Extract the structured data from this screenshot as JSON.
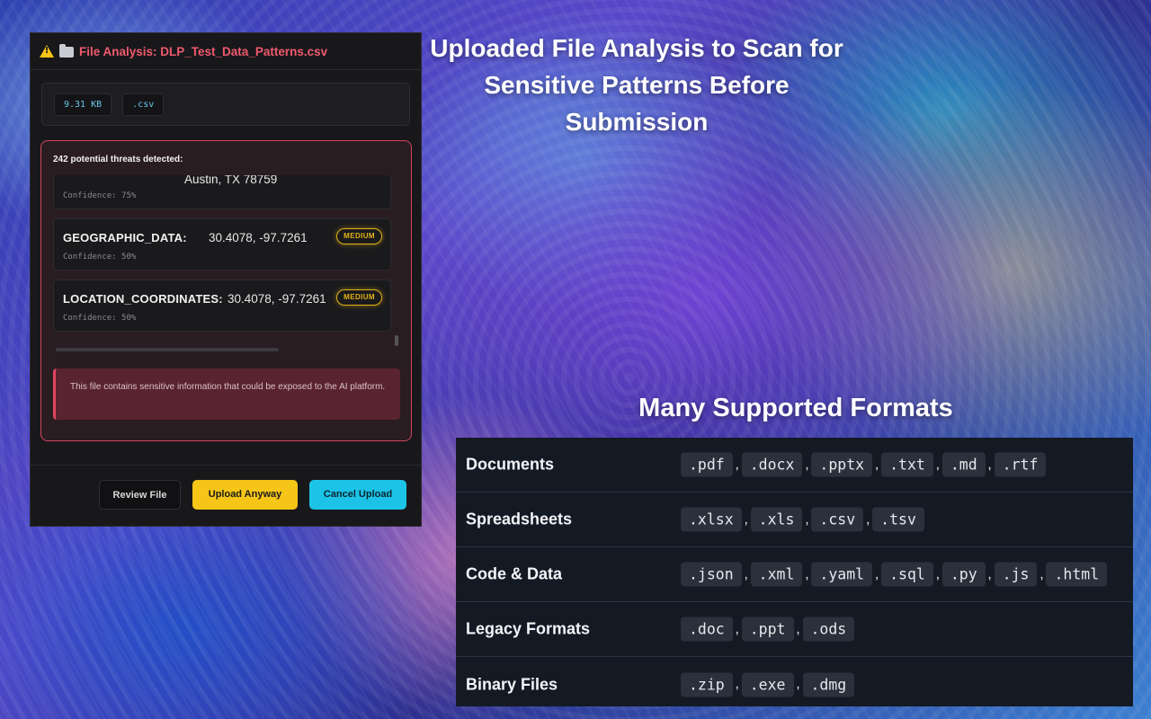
{
  "dialog": {
    "title": "File Analysis: DLP_Test_Data_Patterns.csv",
    "file_size": "9.31 KB",
    "file_ext": ".csv",
    "threats_header": "242 potential threats detected:",
    "threats": [
      {
        "type": "",
        "value": "Austin, TX 78759",
        "confidence": "Confidence: 75%",
        "severity": ""
      },
      {
        "type": "GEOGRAPHIC_DATA:",
        "value": "30.4078, -97.7261",
        "confidence": "Confidence: 50%",
        "severity": "MEDIUM"
      },
      {
        "type": "LOCATION_COORDINATES:",
        "value": "30.4078, -97.7261",
        "confidence": "Confidence: 50%",
        "severity": "MEDIUM"
      }
    ],
    "alert_text": "This file contains sensitive information that could be exposed to the AI platform.",
    "buttons": {
      "review": "Review File",
      "upload": "Upload Anyway",
      "cancel": "Cancel Upload"
    }
  },
  "headline": "Uploaded File Analysis to Scan for Sensitive Patterns Before Submission",
  "formats_title": "Many Supported Formats",
  "formats": [
    {
      "category": "Documents",
      "extensions": [
        ".pdf",
        ".docx",
        ".pptx",
        ".txt",
        ".md",
        ".rtf"
      ]
    },
    {
      "category": "Spreadsheets",
      "extensions": [
        ".xlsx",
        ".xls",
        ".csv",
        ".tsv"
      ]
    },
    {
      "category": "Code & Data",
      "extensions": [
        ".json",
        ".xml",
        ".yaml",
        ".sql",
        ".py",
        ".js",
        ".html"
      ]
    },
    {
      "category": "Legacy Formats",
      "extensions": [
        ".doc",
        ".ppt",
        ".ods"
      ]
    },
    {
      "category": "Binary Files",
      "extensions": [
        ".zip",
        ".exe",
        ".dmg"
      ]
    }
  ],
  "colors": {
    "title_red": "#f05a6e",
    "warning_yellow": "#f5c518",
    "cancel_cyan": "#1cc3e6",
    "threat_border": "#d2465e"
  },
  "icons": [
    "warning-icon",
    "folder-icon"
  ]
}
